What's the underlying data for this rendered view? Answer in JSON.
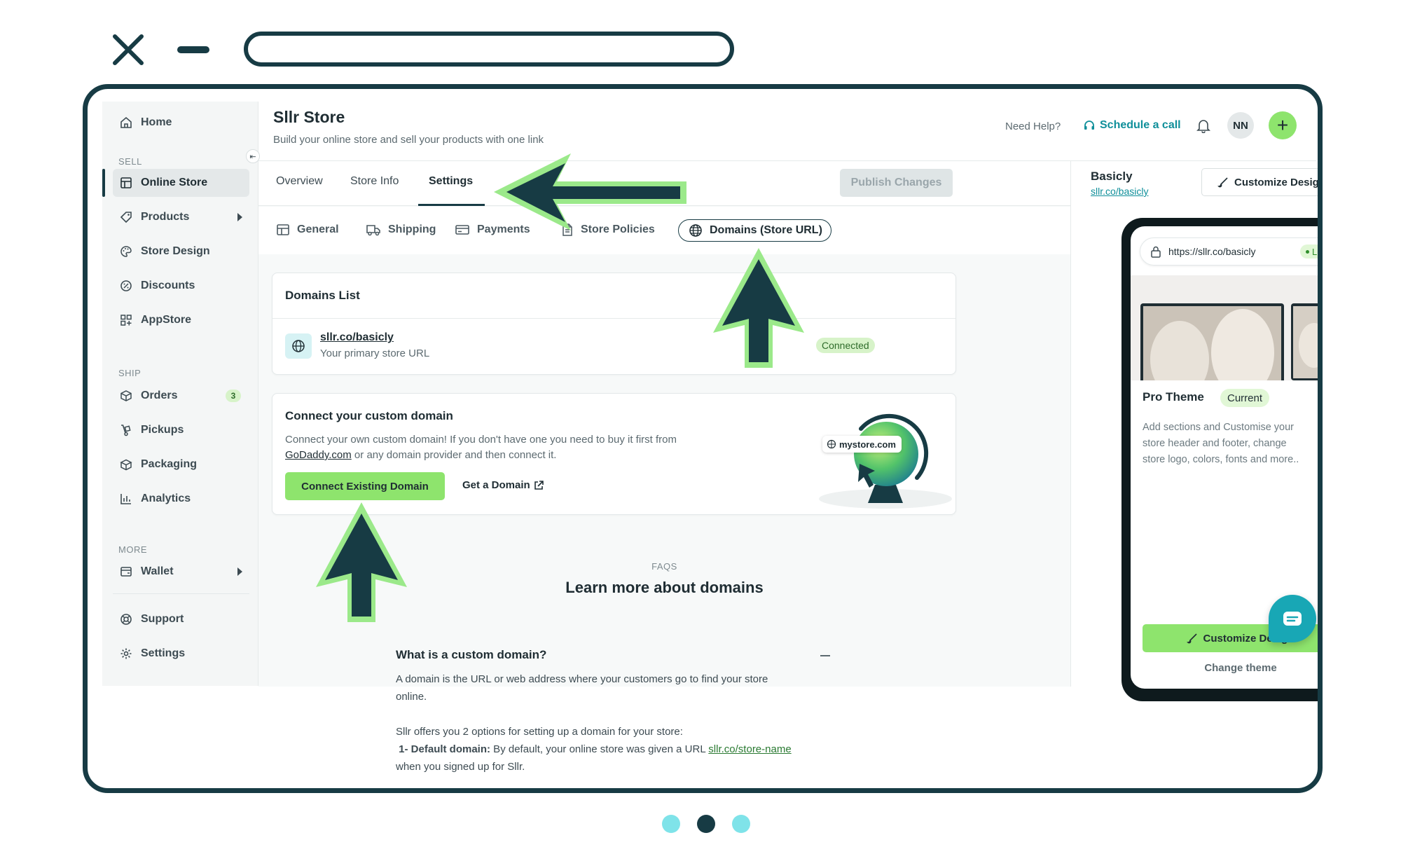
{
  "store": {
    "title": "Sllr Store",
    "subtitle": "Build your online store and sell your products with one link",
    "help_label": "Need Help?",
    "schedule_label": "Schedule a call",
    "avatar_initials": "NN"
  },
  "sidebar": {
    "home": "Home",
    "sections": {
      "sell": "SELL",
      "ship": "SHIP",
      "more": "MORE"
    },
    "sell_items": [
      "Online Store",
      "Products",
      "Store Design",
      "Discounts",
      "AppStore"
    ],
    "ship_items": [
      "Orders",
      "Pickups",
      "Packaging",
      "Analytics"
    ],
    "orders_count": "3",
    "more_items": [
      "Wallet"
    ],
    "bottom_items": [
      "Support",
      "Settings"
    ]
  },
  "tabs": {
    "items": [
      "Overview",
      "Store Info",
      "Settings"
    ],
    "active": "Settings",
    "publish_label": "Publish Changes"
  },
  "subtabs": {
    "items": [
      "General",
      "Shipping",
      "Payments",
      "Store Policies",
      "Domains (Store URL)"
    ],
    "active": "Domains (Store URL)"
  },
  "domains_list": {
    "title": "Domains List",
    "domain": "sllr.co/basicly",
    "domain_desc": "Your primary store URL",
    "status": "Connected"
  },
  "custom_domain": {
    "title": "Connect your custom domain",
    "desc_line1": "Connect your own custom domain! If you don't have one you need to buy it first from",
    "desc_link": "GoDaddy.com",
    "desc_line2": " or any domain provider and then connect it.",
    "connect_label": "Connect Existing Domain",
    "get_domain_label": "Get a Domain",
    "illustration_label": "mystore.com"
  },
  "faqs": {
    "eyebrow": "FAQS",
    "title": "Learn more about domains",
    "question": "What is a custom domain?",
    "answer_line1": "A domain is the URL or web address where your customers go to find your store",
    "answer_line2": "online.",
    "options_intro": "Sllr offers you 2 options for setting up a domain for your store:",
    "option1_label": "1- Default domain:",
    "option1_text": " By default, your online store was given a URL ",
    "option1_link": "sllr.co/store-name",
    "option1_tail": "when you signed up for Sllr."
  },
  "preview": {
    "store_name": "Basicly",
    "store_link": "sllr.co/basicly",
    "customize_label": "Customize Design",
    "url": "https://sllr.co/basicly",
    "live_label": "Live",
    "theme_name": "Pro Theme",
    "current_label": "Current",
    "theme_desc_1": "Add sections and Customise your",
    "theme_desc_2": "store header and footer, change",
    "theme_desc_3": "store logo, colors, fonts and more..",
    "customize_btn_label": "Customize Design",
    "change_theme_label": "Change theme"
  },
  "colors": {
    "brand_dark": "#173b44",
    "accent_green": "#8ee46d",
    "arrow_fill": "#173b44",
    "arrow_glow": "#9be98a",
    "dot_light": "#7fe3e9"
  },
  "pager": {
    "dots": 3,
    "active_index": 1
  }
}
